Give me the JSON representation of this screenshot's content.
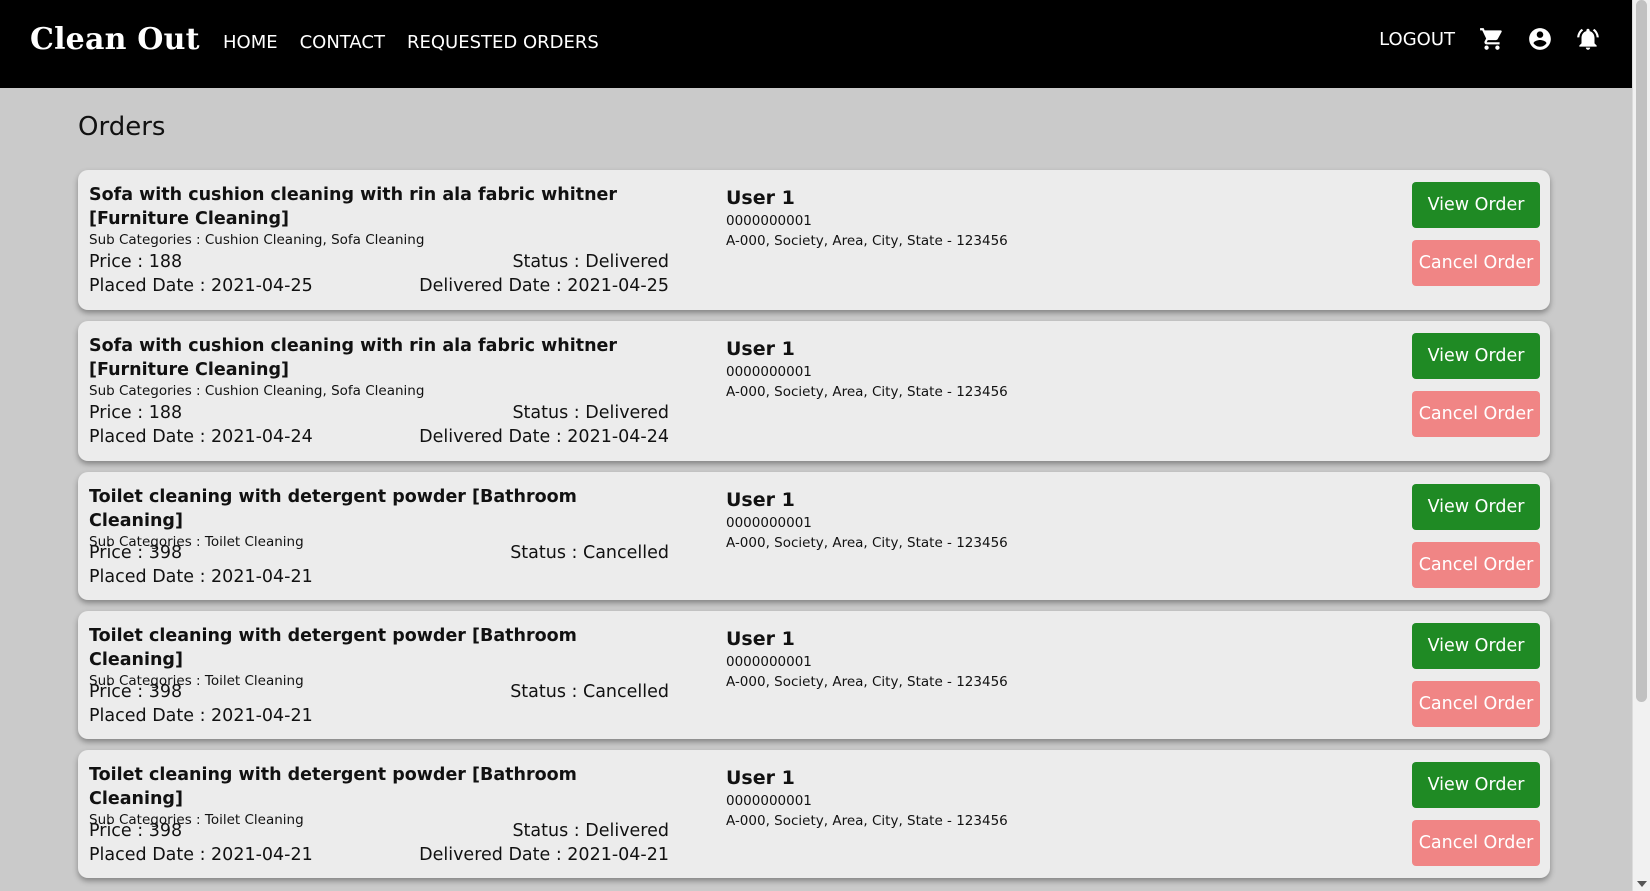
{
  "navbar": {
    "brand": "Clean Out",
    "links": [
      "HOME",
      "CONTACT",
      "REQUESTED ORDERS"
    ],
    "logout": "LOGOUT",
    "icons": [
      "cart-icon",
      "account-icon",
      "notification-bell-icon"
    ]
  },
  "page": {
    "title": "Orders"
  },
  "labels": {
    "view_order": "View Order",
    "cancel_order": "Cancel Order"
  },
  "orders": [
    {
      "title": "Sofa with cushion cleaning with rin ala fabric whitner [Furniture Cleaning]",
      "sub_categories": "Sub Categories : Cushion Cleaning, Sofa Cleaning",
      "price": "Price : 188",
      "status": "Status : Delivered",
      "placed_date": "Placed Date : 2021-04-25",
      "delivered_date": "Delivered Date : 2021-04-25",
      "user": {
        "name": "User 1",
        "phone": "0000000001",
        "address": "A-000, Society, Area, City, State - 123456"
      }
    },
    {
      "title": "Sofa with cushion cleaning with rin ala fabric whitner [Furniture Cleaning]",
      "sub_categories": "Sub Categories : Cushion Cleaning, Sofa Cleaning",
      "price": "Price : 188",
      "status": "Status : Delivered",
      "placed_date": "Placed Date : 2021-04-24",
      "delivered_date": "Delivered Date : 2021-04-24",
      "user": {
        "name": "User 1",
        "phone": "0000000001",
        "address": "A-000, Society, Area, City, State - 123456"
      }
    },
    {
      "title": "Toilet cleaning with detergent powder [Bathroom Cleaning]",
      "sub_categories": "Sub Categories : Toilet Cleaning",
      "price": "Price : 398",
      "status": "Status : Cancelled",
      "placed_date": "Placed Date : 2021-04-21",
      "delivered_date": "",
      "user": {
        "name": "User 1",
        "phone": "0000000001",
        "address": "A-000, Society, Area, City, State - 123456"
      }
    },
    {
      "title": "Toilet cleaning with detergent powder [Bathroom Cleaning]",
      "sub_categories": "Sub Categories : Toilet Cleaning",
      "price": "Price : 398",
      "status": "Status : Cancelled",
      "placed_date": "Placed Date : 2021-04-21",
      "delivered_date": "",
      "user": {
        "name": "User 1",
        "phone": "0000000001",
        "address": "A-000, Society, Area, City, State - 123456"
      }
    },
    {
      "title": "Toilet cleaning with detergent powder [Bathroom Cleaning]",
      "sub_categories": "Sub Categories : Toilet Cleaning",
      "price": "Price : 398",
      "status": "Status : Delivered",
      "placed_date": "Placed Date : 2021-04-21",
      "delivered_date": "Delivered Date : 2021-04-21",
      "user": {
        "name": "User 1",
        "phone": "0000000001",
        "address": "A-000, Society, Area, City, State - 123456"
      }
    }
  ],
  "colors": {
    "navbar_bg": "#000000",
    "page_bg": "#cacaca",
    "card_bg": "#ececec",
    "view_button": "#1f8a24",
    "cancel_button": "#f08585"
  }
}
